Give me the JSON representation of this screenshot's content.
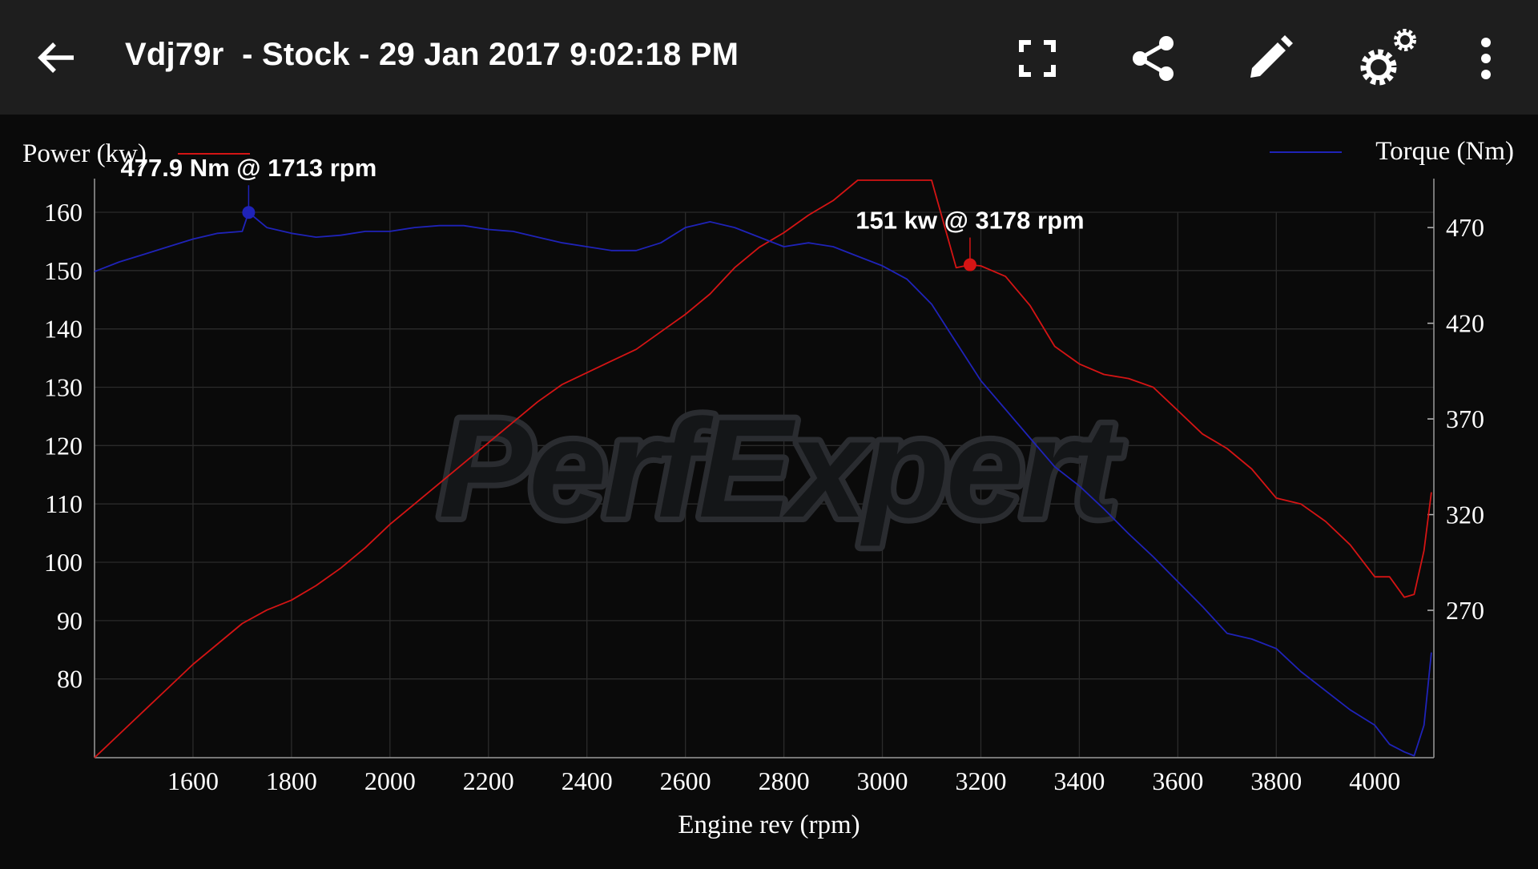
{
  "appbar": {
    "title": "Vdj79r  - Stock - 29 Jan 2017 9:02:18 PM",
    "icons": [
      "back-arrow-icon",
      "fullscreen-icon",
      "share-icon",
      "edit-pencil-icon",
      "settings-gears-icon",
      "more-vert-icon"
    ]
  },
  "chart_data": {
    "type": "line",
    "title": "",
    "xlabel": "Engine rev (rpm)",
    "ylabel_left": "",
    "ylabel_right": "",
    "xlim": [
      1400,
      4120
    ],
    "ylim_left": [
      66.5,
      160
    ],
    "ylim_right": [
      193,
      478
    ],
    "x_ticks": [
      1600,
      1800,
      2000,
      2200,
      2400,
      2600,
      2800,
      3000,
      3200,
      3400,
      3600,
      3800,
      4000
    ],
    "y_left_ticks": [
      80,
      90,
      100,
      110,
      120,
      130,
      140,
      150,
      160
    ],
    "y_right_ticks": [
      270,
      320,
      370,
      420,
      470
    ],
    "grid": true,
    "legend": [
      {
        "label": "Power (kw)",
        "position": "top-left",
        "color": "#d41414"
      },
      {
        "label": "Torque (Nm)",
        "position": "top-right",
        "color": "#1f23b8"
      }
    ],
    "watermark": "PerfExpert",
    "series": [
      {
        "name": "Power (kw)",
        "axis": "left",
        "color": "#d41414",
        "x": [
          1400,
          1450,
          1500,
          1550,
          1600,
          1650,
          1700,
          1750,
          1800,
          1850,
          1900,
          1950,
          2000,
          2050,
          2100,
          2150,
          2200,
          2250,
          2300,
          2350,
          2400,
          2450,
          2500,
          2550,
          2600,
          2650,
          2700,
          2750,
          2800,
          2850,
          2900,
          2950,
          3000,
          3050,
          3100,
          3150,
          3178,
          3200,
          3250,
          3300,
          3350,
          3400,
          3450,
          3500,
          3550,
          3600,
          3650,
          3700,
          3750,
          3800,
          3850,
          3900,
          3950,
          4000,
          4030,
          4060,
          4080,
          4100,
          4115
        ],
        "values": [
          66.5,
          70.5,
          74.5,
          78.5,
          82.5,
          86.0,
          89.5,
          91.8,
          93.5,
          96.0,
          99.0,
          102.5,
          106.5,
          110.0,
          113.5,
          117.0,
          120.5,
          124.0,
          127.5,
          130.5,
          132.5,
          134.5,
          136.5,
          139.5,
          142.5,
          146.0,
          150.5,
          154.0,
          156.5,
          159.5,
          162.0,
          165.5,
          169.5,
          172.5,
          174.0,
          150.5,
          151.0,
          150.8,
          149.0,
          144.0,
          137.0,
          134.0,
          132.2,
          131.5,
          130.0,
          126.0,
          122.0,
          119.5,
          116.0,
          111.0,
          110.0,
          107.0,
          103.0,
          97.5,
          97.5,
          94.0,
          94.5,
          102.0,
          112.0
        ]
      },
      {
        "name": "Torque (Nm)",
        "axis": "right",
        "color": "#1f23b8",
        "x": [
          1400,
          1450,
          1500,
          1550,
          1600,
          1650,
          1700,
          1713,
          1750,
          1800,
          1850,
          1900,
          1950,
          2000,
          2050,
          2100,
          2150,
          2200,
          2250,
          2300,
          2350,
          2400,
          2450,
          2500,
          2550,
          2600,
          2650,
          2700,
          2750,
          2800,
          2850,
          2900,
          2950,
          3000,
          3050,
          3100,
          3150,
          3200,
          3250,
          3300,
          3350,
          3400,
          3450,
          3500,
          3550,
          3600,
          3650,
          3700,
          3750,
          3800,
          3850,
          3900,
          3950,
          4000,
          4030,
          4060,
          4080,
          4100,
          4115
        ],
        "values": [
          447,
          452,
          456,
          460,
          464,
          467,
          468,
          477.9,
          470,
          467,
          465,
          466,
          468,
          468,
          470,
          471,
          471,
          469,
          468,
          465,
          462,
          460,
          458,
          458,
          462,
          470,
          473,
          470,
          465,
          460,
          462,
          460,
          455,
          450,
          443,
          430,
          410,
          390,
          375,
          360,
          345,
          335,
          323,
          310,
          298,
          285,
          272,
          258,
          255,
          250,
          238,
          228,
          218,
          210,
          200,
          196,
          194,
          210,
          248
        ]
      }
    ],
    "annotations": [
      {
        "text": "151 kw @ 3178 rpm",
        "x": 3178,
        "y": 151,
        "axis": "left",
        "color": "#d41414"
      },
      {
        "text": "477.9 Nm @ 1713 rpm",
        "x": 1713,
        "y": 477.9,
        "axis": "right",
        "color": "#1f23b8"
      }
    ]
  }
}
